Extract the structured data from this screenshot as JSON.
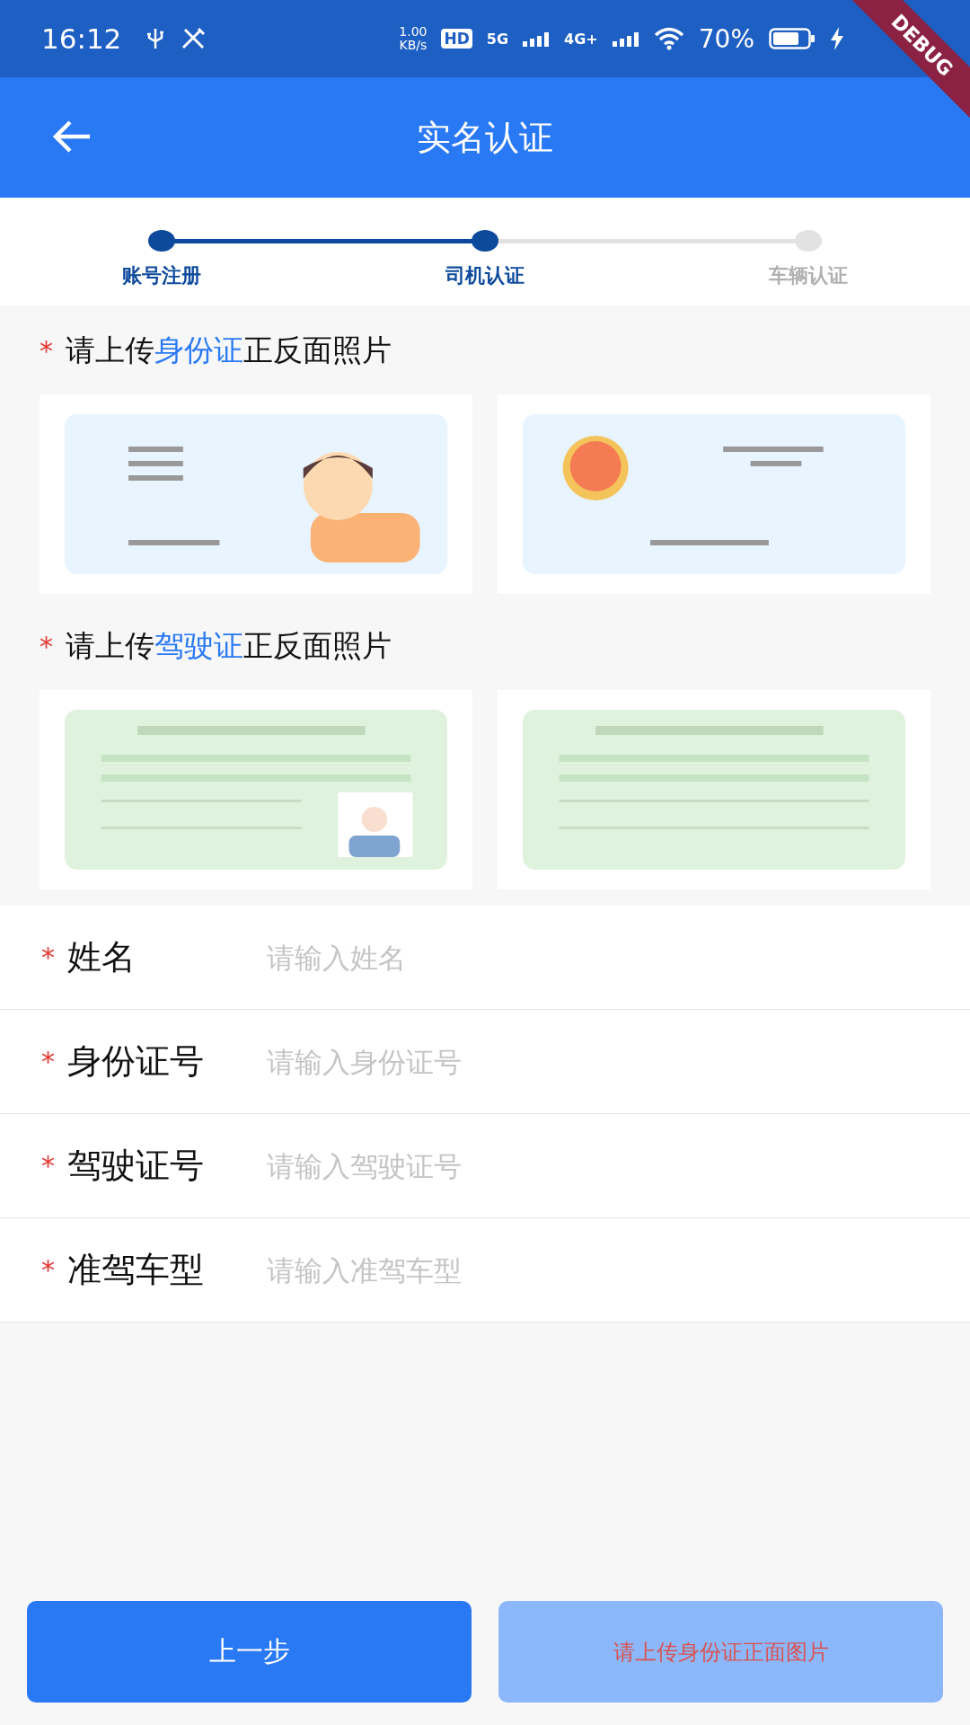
{
  "status_bar": {
    "time": "16:12",
    "speed_value": "1.00",
    "speed_unit": "KB/s",
    "hd": "HD",
    "network_1": "5G",
    "network_2": "4G+",
    "battery": "70%"
  },
  "debug_banner": "DEBUG",
  "app_bar": {
    "title": "实名认证"
  },
  "steps": [
    {
      "label": "账号注册",
      "completed": true
    },
    {
      "label": "司机认证",
      "completed": true
    },
    {
      "label": "车辆认证",
      "completed": false
    }
  ],
  "upload_sections": [
    {
      "required_mark": "*",
      "prefix": "请上传",
      "highlight": "身份证",
      "suffix": "正反面照片"
    },
    {
      "required_mark": "*",
      "prefix": "请上传",
      "highlight": "驾驶证",
      "suffix": "正反面照片"
    }
  ],
  "form_fields": [
    {
      "required_mark": "*",
      "label": "姓名",
      "placeholder": "请输入姓名"
    },
    {
      "required_mark": "*",
      "label": "身份证号",
      "placeholder": "请输入身份证号"
    },
    {
      "required_mark": "*",
      "label": "驾驶证号",
      "placeholder": "请输入驾驶证号"
    },
    {
      "required_mark": "*",
      "label": "准驾车型",
      "placeholder": "请输入准驾车型"
    }
  ],
  "buttons": [
    {
      "label": "上一步",
      "disabled": false
    },
    {
      "label": "请上传身份证正面图片",
      "disabled": true
    }
  ]
}
